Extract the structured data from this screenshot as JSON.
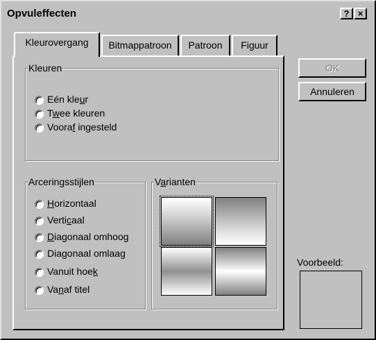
{
  "window": {
    "title": "Opvuleffecten",
    "help_glyph": "?",
    "close_glyph": "×"
  },
  "tabs": [
    {
      "label": "Kleurovergang",
      "active": true
    },
    {
      "label": "Bitmappatroon",
      "active": false
    },
    {
      "label": "Patroon",
      "active": false
    },
    {
      "label": "Figuur",
      "active": false
    }
  ],
  "kleuren": {
    "legend": "Kleuren",
    "options": [
      {
        "pre": "Eén kle",
        "key": "u",
        "post": "r"
      },
      {
        "pre": "T",
        "key": "w",
        "post": "ee kleuren"
      },
      {
        "pre": "Voora",
        "key": "f",
        "post": " ingesteld"
      }
    ]
  },
  "arcering": {
    "legend": "Arceringsstijlen",
    "options": [
      {
        "pre": "",
        "key": "H",
        "post": "orizontaal"
      },
      {
        "pre": "Verti",
        "key": "c",
        "post": "aal"
      },
      {
        "pre": "",
        "key": "D",
        "post": "iagonaal omhoog"
      },
      {
        "pre": "Diagonaal omlaa",
        "key": "g",
        "post": ""
      },
      {
        "pre": "Vanuit hoe",
        "key": "k",
        "post": ""
      },
      {
        "pre": "Va",
        "key": "n",
        "post": "af titel"
      }
    ]
  },
  "varianten": {
    "legend_pre": "V",
    "legend_key": "a",
    "legend_post": "rianten"
  },
  "buttons": {
    "ok": "OK",
    "cancel": "Annuleren"
  },
  "preview_label": "Voorbeeld:",
  "colors": {
    "face": "#c0c0c0",
    "highlight": "#ffffff",
    "shadow": "#808080",
    "dark": "#000000"
  }
}
